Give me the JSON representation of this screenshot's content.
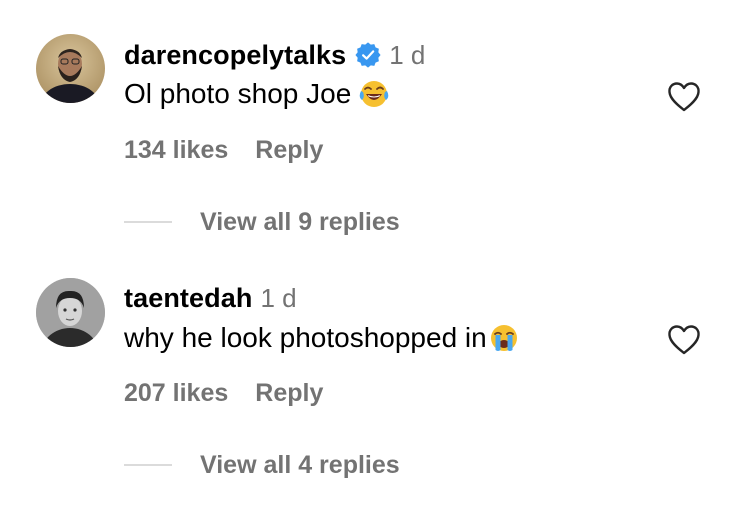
{
  "comments": [
    {
      "username": "darencopelytalks",
      "verified": true,
      "time": "1 d",
      "text": "Ol photo shop Joe",
      "emoji": "face-with-tears-of-joy",
      "likes": "134 likes",
      "reply_label": "Reply",
      "view_replies": "View all 9 replies"
    },
    {
      "username": "taentedah",
      "verified": false,
      "time": "1 d",
      "text": "why he look photoshopped in",
      "emoji": "loudly-crying-face",
      "likes": "207 likes",
      "reply_label": "Reply",
      "view_replies": "View all 4 replies"
    }
  ],
  "colors": {
    "primary_text": "#000000",
    "secondary_text": "#737373",
    "verified_badge": "#3897f0",
    "divider": "#dbdbdb"
  }
}
